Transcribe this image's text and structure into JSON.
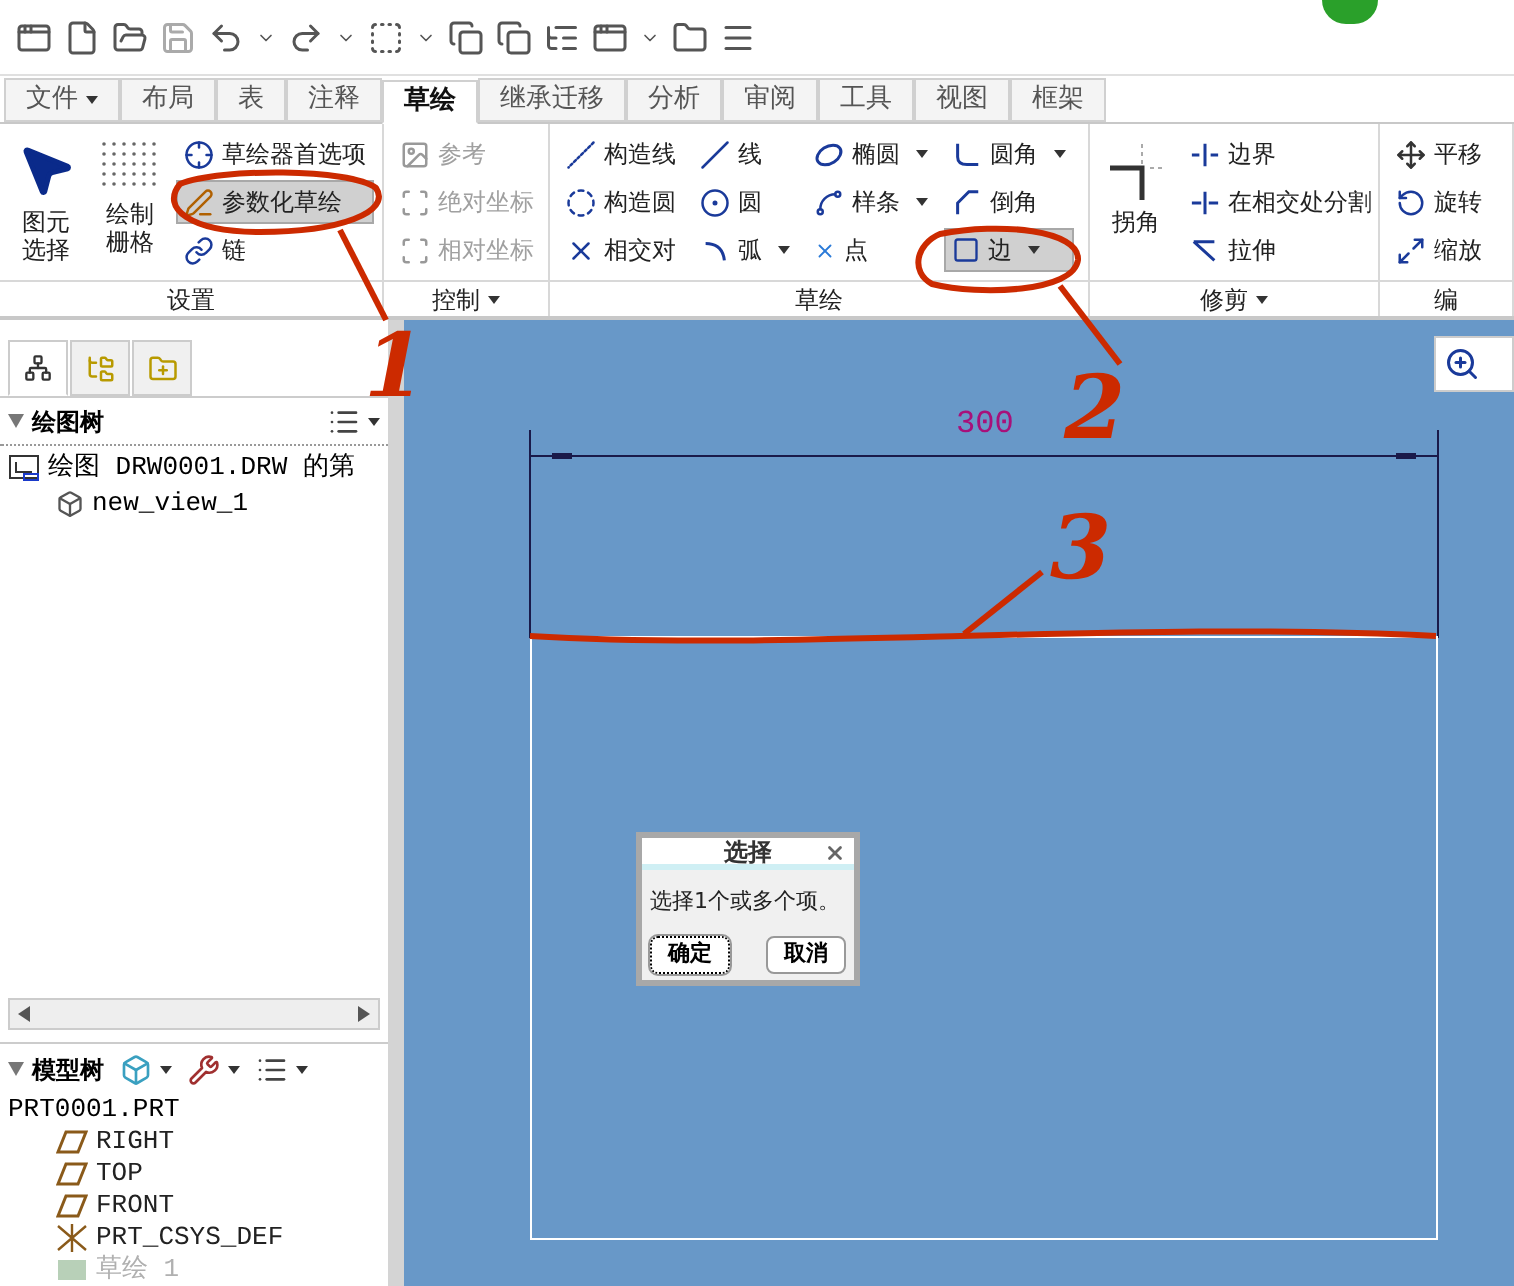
{
  "tabs": [
    {
      "label": "文件",
      "dropdown": true,
      "selected": false
    },
    {
      "label": "布局",
      "dropdown": false,
      "selected": false
    },
    {
      "label": "表",
      "dropdown": false,
      "selected": false
    },
    {
      "label": "注释",
      "dropdown": false,
      "selected": false
    },
    {
      "label": "草绘",
      "dropdown": false,
      "selected": true
    },
    {
      "label": "继承迁移",
      "dropdown": false,
      "selected": false
    },
    {
      "label": "分析",
      "dropdown": false,
      "selected": false
    },
    {
      "label": "审阅",
      "dropdown": false,
      "selected": false
    },
    {
      "label": "工具",
      "dropdown": false,
      "selected": false
    },
    {
      "label": "视图",
      "dropdown": false,
      "selected": false
    },
    {
      "label": "框架",
      "dropdown": false,
      "selected": false
    }
  ],
  "ribbon": [
    {
      "label": "设置",
      "dropdown": false,
      "large": [
        {
          "label": "图元选择"
        },
        {
          "label": "绘制栅格"
        }
      ],
      "columns": [
        [
          {
            "label": "草绘器首选项",
            "dropdown": false,
            "disabled": false,
            "selected": false
          },
          {
            "label": "参数化草绘",
            "dropdown": false,
            "disabled": false,
            "selected": true
          },
          {
            "label": "链",
            "dropdown": false,
            "disabled": false,
            "selected": false
          }
        ]
      ]
    },
    {
      "label": "控制",
      "dropdown": true,
      "columns": [
        [
          {
            "label": "参考",
            "dropdown": false,
            "disabled": true,
            "selected": false
          },
          {
            "label": "绝对坐标",
            "dropdown": false,
            "disabled": true,
            "selected": false
          },
          {
            "label": "相对坐标",
            "dropdown": false,
            "disabled": true,
            "selected": false
          }
        ]
      ]
    },
    {
      "label": "草绘",
      "dropdown": false,
      "columns": [
        [
          {
            "label": "构造线",
            "dropdown": false,
            "disabled": false,
            "selected": false
          },
          {
            "label": "构造圆",
            "dropdown": false,
            "disabled": false,
            "selected": false
          },
          {
            "label": "相交对",
            "dropdown": false,
            "disabled": false,
            "selected": false
          }
        ],
        [
          {
            "label": "线",
            "dropdown": false,
            "disabled": false,
            "selected": false
          },
          {
            "label": "圆",
            "dropdown": false,
            "disabled": false,
            "selected": false
          },
          {
            "label": "弧",
            "dropdown": true,
            "disabled": false,
            "selected": false
          }
        ],
        [
          {
            "label": "椭圆",
            "dropdown": true,
            "disabled": false,
            "selected": false
          },
          {
            "label": "样条",
            "dropdown": true,
            "disabled": false,
            "selected": false
          },
          {
            "label": "点",
            "dropdown": false,
            "disabled": false,
            "selected": false
          }
        ],
        [
          {
            "label": "圆角",
            "dropdown": true,
            "disabled": false,
            "selected": false
          },
          {
            "label": "倒角",
            "dropdown": false,
            "disabled": false,
            "selected": false
          },
          {
            "label": "边",
            "dropdown": true,
            "disabled": false,
            "selected": true
          }
        ]
      ]
    },
    {
      "label": "修剪",
      "dropdown": true,
      "large": [
        {
          "label": "拐角"
        }
      ],
      "columns": [
        [
          {
            "label": "边界",
            "dropdown": false,
            "disabled": false,
            "selected": false
          },
          {
            "label": "在相交处分割",
            "dropdown": false,
            "disabled": false,
            "selected": false
          },
          {
            "label": "拉伸",
            "dropdown": false,
            "disabled": false,
            "selected": false
          }
        ]
      ]
    },
    {
      "label": "编",
      "dropdown": false,
      "columns": [
        [
          {
            "label": "平移",
            "dropdown": false,
            "disabled": false,
            "selected": false
          },
          {
            "label": "旋转",
            "dropdown": false,
            "disabled": false,
            "selected": false
          },
          {
            "label": "缩放",
            "dropdown": false,
            "disabled": false,
            "selected": false
          }
        ]
      ]
    }
  ],
  "panel_tabs": [
    {
      "selected": true
    },
    {
      "selected": false
    },
    {
      "selected": false
    }
  ],
  "drawing_tree": {
    "title": "绘图树",
    "items": [
      {
        "label": "绘图 DRW0001.DRW 的第",
        "children": [
          {
            "label": "new_view_1"
          }
        ]
      }
    ]
  },
  "model_tree": {
    "title": "模型树",
    "items": [
      {
        "label": "PRT0001.PRT",
        "children": [
          {
            "label": "RIGHT",
            "kind": "plane",
            "disabled": false
          },
          {
            "label": "TOP",
            "kind": "plane",
            "disabled": false
          },
          {
            "label": "FRONT",
            "kind": "plane",
            "disabled": false
          },
          {
            "label": "PRT_CSYS_DEF",
            "kind": "csys",
            "disabled": false
          },
          {
            "label": "草绘 1",
            "kind": "sketch",
            "disabled": true
          }
        ]
      }
    ]
  },
  "canvas": {
    "dimension": "300",
    "dialog": {
      "title": "选择",
      "message": "选择1个或多个项。",
      "buttons": [
        {
          "label": "确定",
          "focused": true
        },
        {
          "label": "取消",
          "focused": false
        }
      ]
    }
  },
  "annotations": [
    {
      "label": "1"
    },
    {
      "label": "2"
    },
    {
      "label": "3"
    }
  ]
}
